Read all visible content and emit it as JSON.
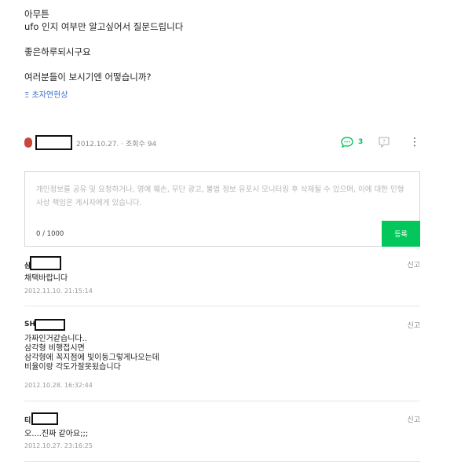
{
  "post": {
    "lines": [
      "아무튼",
      "ufo 인지 여부만 알고싶어서 질문드립니다",
      "",
      "좋은하루되시구요",
      "",
      "여러분들이 보시기엔 어떻습니까?"
    ],
    "tag": "Ξ 초자연현상"
  },
  "meta": {
    "date": "2012.10.27.",
    "views_label": "조회수 94",
    "comment_count": "3",
    "comment_icon": "speech-bubble-icon",
    "report_icon": "report-icon",
    "more_icon": "more-vertical-icon"
  },
  "editor": {
    "placeholder": "개인정보를 공유 및 요청하거나, 명예 훼손, 무단 광고, 불법 정보 유포시 모니터링 후 삭제될 수 있으며, 이에 대한 민형사상 책임은 게시자에게 있습니다.",
    "counter": "0 / 1000",
    "submit_label": "등록",
    "accent": "#03c75a"
  },
  "comments": [
    {
      "author": "삼",
      "report": "신고",
      "body": "채택바랍니다",
      "date": "2012.11.10. 21:15:14"
    },
    {
      "author": "SH",
      "report": "신고",
      "body": "가짜인거같습니다..\n삼각형 비행접시면\n삼각형에 꼭지점에 빛이둥그렇게나오는데\n비율이랑 각도가잘못됬습니다",
      "date": "2012.10.28. 16:32:44"
    },
    {
      "author": "티",
      "report": "신고",
      "body": "오....진짜 같아요;;;",
      "date": "2012.10.27. 23:16:25"
    }
  ]
}
